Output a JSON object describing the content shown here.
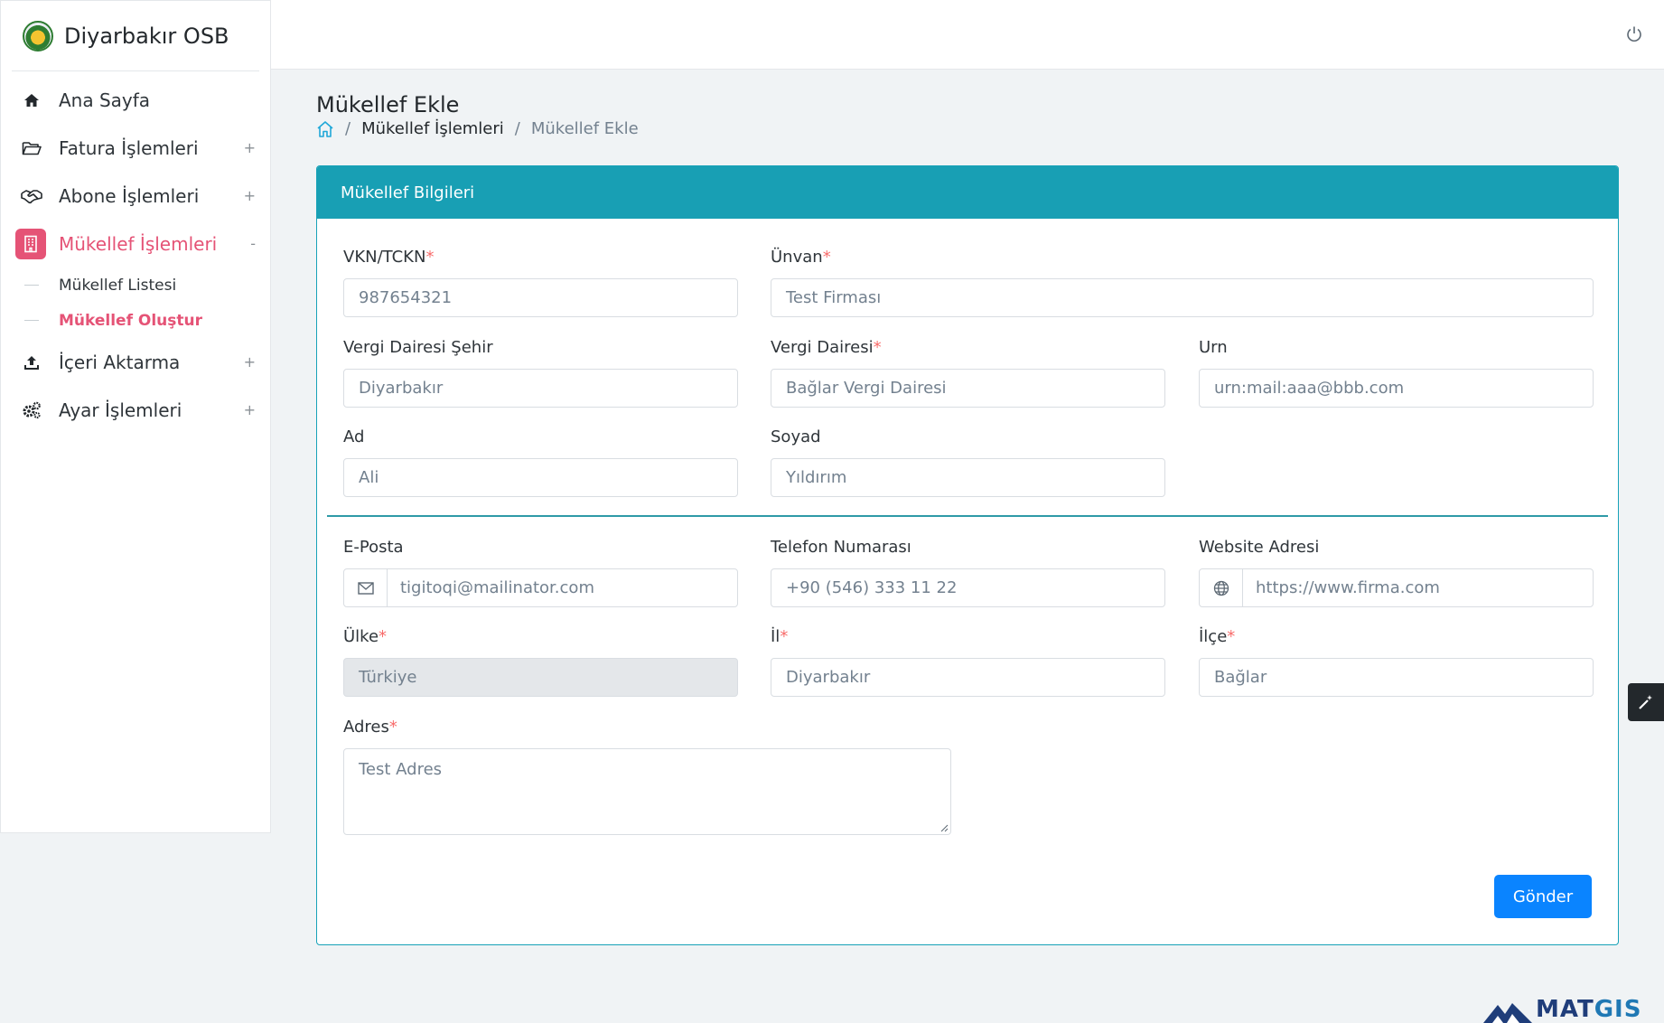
{
  "brand": {
    "title": "Diyarbakır OSB"
  },
  "sidebar": {
    "items": [
      {
        "label": "Ana Sayfa",
        "icon": "home-icon",
        "toggle": ""
      },
      {
        "label": "Fatura İşlemleri",
        "icon": "folder-open-icon",
        "toggle": "+"
      },
      {
        "label": "Abone İşlemleri",
        "icon": "handshake-icon",
        "toggle": "+"
      },
      {
        "label": "Mükellef İşlemleri",
        "icon": "building-icon",
        "toggle": "-"
      },
      {
        "label": "İçeri Aktarma",
        "icon": "upload-icon",
        "toggle": "+"
      },
      {
        "label": "Ayar İşlemleri",
        "icon": "gears-icon",
        "toggle": "+"
      }
    ],
    "subitems": [
      {
        "label": "Mükellef Listesi"
      },
      {
        "label": "Mükellef Oluştur"
      }
    ]
  },
  "page": {
    "title": "Mükellef Ekle",
    "breadcrumb": {
      "sep": "/",
      "item1": "Mükellef İşlemleri",
      "current": "Mükellef Ekle"
    }
  },
  "card": {
    "title": "Mükellef Bilgileri",
    "required_mark": "*",
    "fields": {
      "vkn": {
        "label": "VKN/TCKN",
        "value": "987654321"
      },
      "unvan": {
        "label": "Ünvan",
        "value": "Test Firması"
      },
      "vergi_sehir": {
        "label": "Vergi Dairesi Şehir",
        "value": "Diyarbakır"
      },
      "vergi_dairesi": {
        "label": "Vergi Dairesi",
        "value": "Bağlar Vergi Dairesi"
      },
      "urn": {
        "label": "Urn",
        "value": "urn:mail:aaa@bbb.com"
      },
      "ad": {
        "label": "Ad",
        "value": "Ali"
      },
      "soyad": {
        "label": "Soyad",
        "value": "Yıldırım"
      },
      "eposta": {
        "label": "E-Posta",
        "value": "tigitoqi@mailinator.com"
      },
      "telefon": {
        "label": "Telefon Numarası",
        "value": "+90 (546) 333 11 22"
      },
      "website": {
        "label": "Website Adresi",
        "value": "https://www.firma.com"
      },
      "ulke": {
        "label": "Ülke",
        "value": "Türkiye"
      },
      "il": {
        "label": "İl",
        "value": "Diyarbakır"
      },
      "ilce": {
        "label": "İlçe",
        "value": "Bağlar"
      },
      "adres": {
        "label": "Adres",
        "value": "Test Adres"
      }
    },
    "submit_label": "Gönder"
  },
  "footer": {
    "logo_text_a": "MAT",
    "logo_text_b": "GIS"
  },
  "colors": {
    "accent": "#189fb4",
    "active": "#e55376",
    "primary": "#0a84ff",
    "required": "#f86c6b"
  }
}
